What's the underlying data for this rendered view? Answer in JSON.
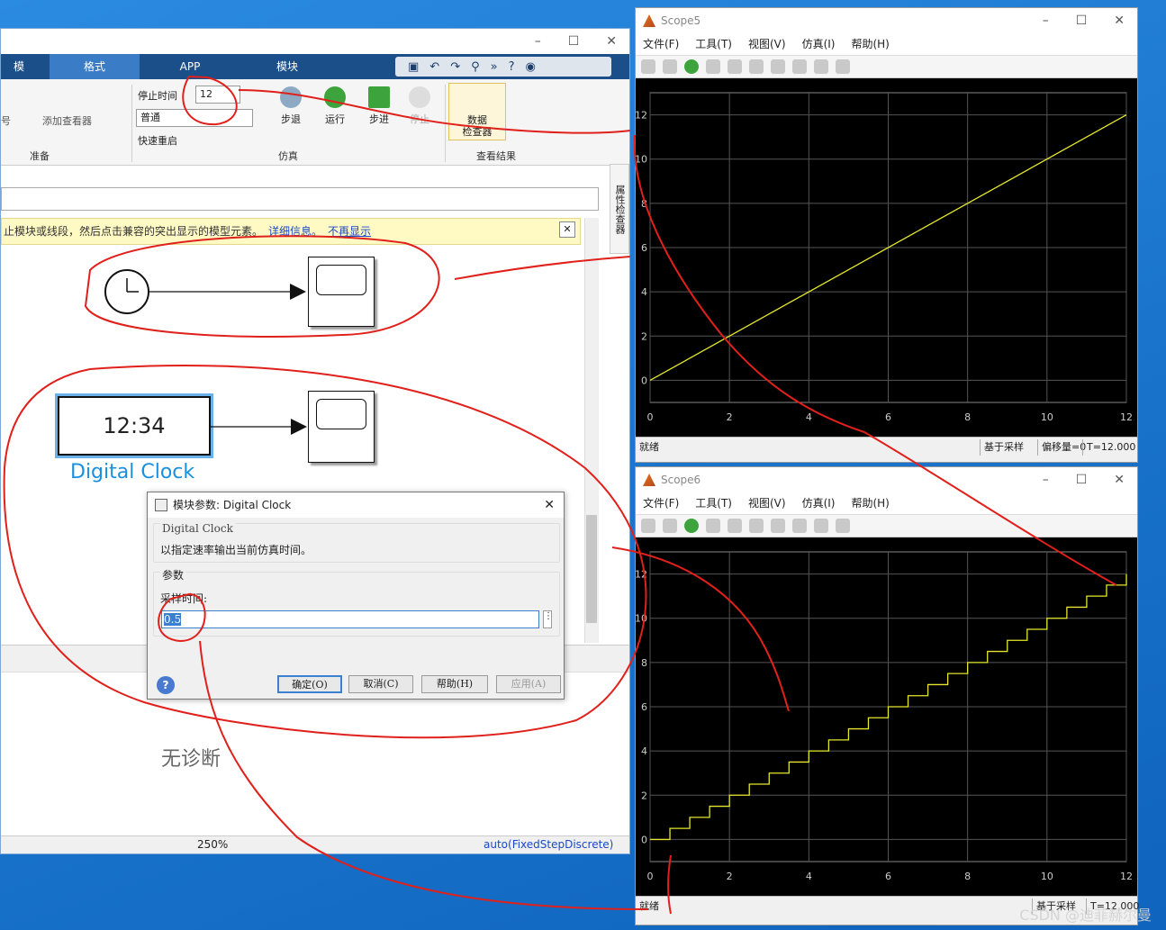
{
  "simulink": {
    "tabs": [
      "模",
      "格式",
      "APP",
      "模块"
    ],
    "ribbon": {
      "signal_label": "号",
      "add_viewer_label": "添加查看器",
      "prepare_group": "准备",
      "stop_time_label": "停止时间",
      "stop_time_value": "12",
      "sim_mode": "普通",
      "fast_restart": "快速重启",
      "step_back": "步退",
      "run": "运行",
      "step_forward": "步进",
      "stop": "停止",
      "simulate_group": "仿真",
      "data_inspector": "数据\n检查器",
      "review_group": "查看结果"
    },
    "property_inspector": "属性检查器",
    "info_bar": {
      "text": "止模块或线段，然后点击兼容的突出显示的模型元素。",
      "link1": "详细信息。",
      "link2": "不再显示"
    },
    "digital_clock": {
      "display": "12:34",
      "label": "Digital Clock"
    },
    "diagnostics": "无诊断",
    "status": {
      "zoom": "250%",
      "solver": "auto(FixedStepDiscrete)"
    }
  },
  "dialog": {
    "title": "模块参数: Digital Clock",
    "block_name": "Digital Clock",
    "description": "以指定速率输出当前仿真时间。",
    "params_header": "参数",
    "sample_time_label": "采样时间:",
    "sample_time_value": "0.5",
    "ok": "确定(O)",
    "cancel": "取消(C)",
    "help": "帮助(H)",
    "apply": "应用(A)"
  },
  "scope5": {
    "title": "Scope5",
    "menu": [
      "文件(F)",
      "工具(T)",
      "视图(V)",
      "仿真(I)",
      "帮助(H)"
    ],
    "status": {
      "left": "就绪",
      "mode": "基于采样",
      "offset": "偏移量=0",
      "time": "T=12.000"
    }
  },
  "scope6": {
    "title": "Scope6",
    "menu": [
      "文件(F)",
      "工具(T)",
      "视图(V)",
      "仿真(I)",
      "帮助(H)"
    ],
    "status": {
      "left": "就绪",
      "mode": "基于采样",
      "time": "T=12.000"
    }
  },
  "watermark": "CSDN @迪菲赫尔曼",
  "colors": {
    "trace": "#e6e62e",
    "annotation": "#e0201b",
    "accent": "#1a8fe0"
  },
  "chart_data": [
    {
      "type": "line",
      "title": "",
      "x": [
        0,
        12
      ],
      "y": [
        0,
        12
      ],
      "xlim": [
        0,
        12
      ],
      "ylim": [
        -1,
        13
      ],
      "xticks": [
        0,
        2,
        4,
        6,
        8,
        10,
        12
      ],
      "yticks": [
        0,
        2,
        4,
        6,
        8,
        10,
        12
      ],
      "grid": true
    },
    {
      "type": "line",
      "title": "",
      "step": true,
      "sample_time": 0.5,
      "x": [
        0,
        0.5,
        1,
        1.5,
        2,
        2.5,
        3,
        3.5,
        4,
        4.5,
        5,
        5.5,
        6,
        6.5,
        7,
        7.5,
        8,
        8.5,
        9,
        9.5,
        10,
        10.5,
        11,
        11.5,
        12
      ],
      "y": [
        0,
        0.5,
        1,
        1.5,
        2,
        2.5,
        3,
        3.5,
        4,
        4.5,
        5,
        5.5,
        6,
        6.5,
        7,
        7.5,
        8,
        8.5,
        9,
        9.5,
        10,
        10.5,
        11,
        11.5,
        12
      ],
      "xlim": [
        0,
        12
      ],
      "ylim": [
        -1,
        13
      ],
      "xticks": [
        0,
        2,
        4,
        6,
        8,
        10,
        12
      ],
      "yticks": [
        0,
        2,
        4,
        6,
        8,
        10,
        12
      ],
      "grid": true
    }
  ]
}
